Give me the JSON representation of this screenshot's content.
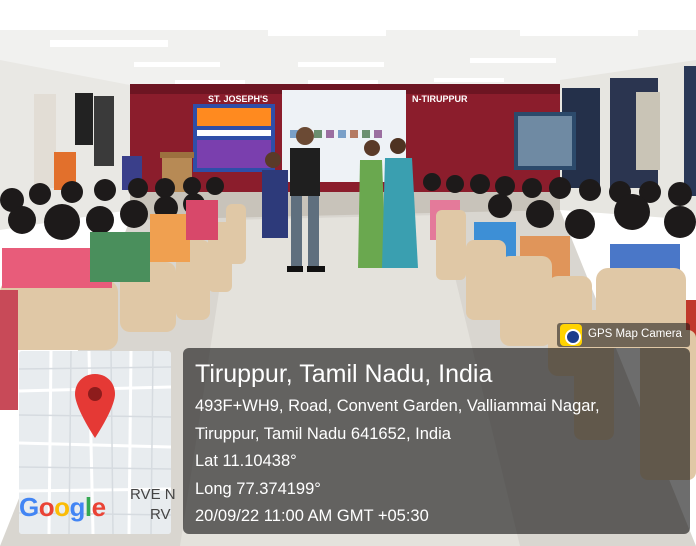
{
  "scene": {
    "banner_left": "ST. JOSEPH'S",
    "banner_right": "N-TIRUPPUR"
  },
  "gps_overlay": {
    "badge_label": "GPS Map Camera",
    "location_title": "Tiruppur, Tamil Nadu, India",
    "address_line_1": "493F+WH9, Road, Convent Garden, Valliammai Nagar,",
    "address_line_2": "Tiruppur, Tamil Nadu 641652, India",
    "latitude": "Lat 11.10438°",
    "longitude": "Long 77.374199°",
    "timestamp": "20/09/22 11:00 AM GMT +05:30"
  },
  "map_thumbnail": {
    "label_1": "RVE N",
    "label_2": "RV",
    "logo_text": "Google",
    "logo_colors": [
      "#4285F4",
      "#EA4335",
      "#FBBC05",
      "#4285F4",
      "#34A853",
      "#EA4335"
    ],
    "pin_color": "#e53935",
    "pin_icon": "map-pin-icon"
  },
  "colors": {
    "wall": "#f3f3f1",
    "stage_curtain": "#8b1d2c",
    "floor": "#d9d6d0",
    "overlay": "#141414"
  }
}
